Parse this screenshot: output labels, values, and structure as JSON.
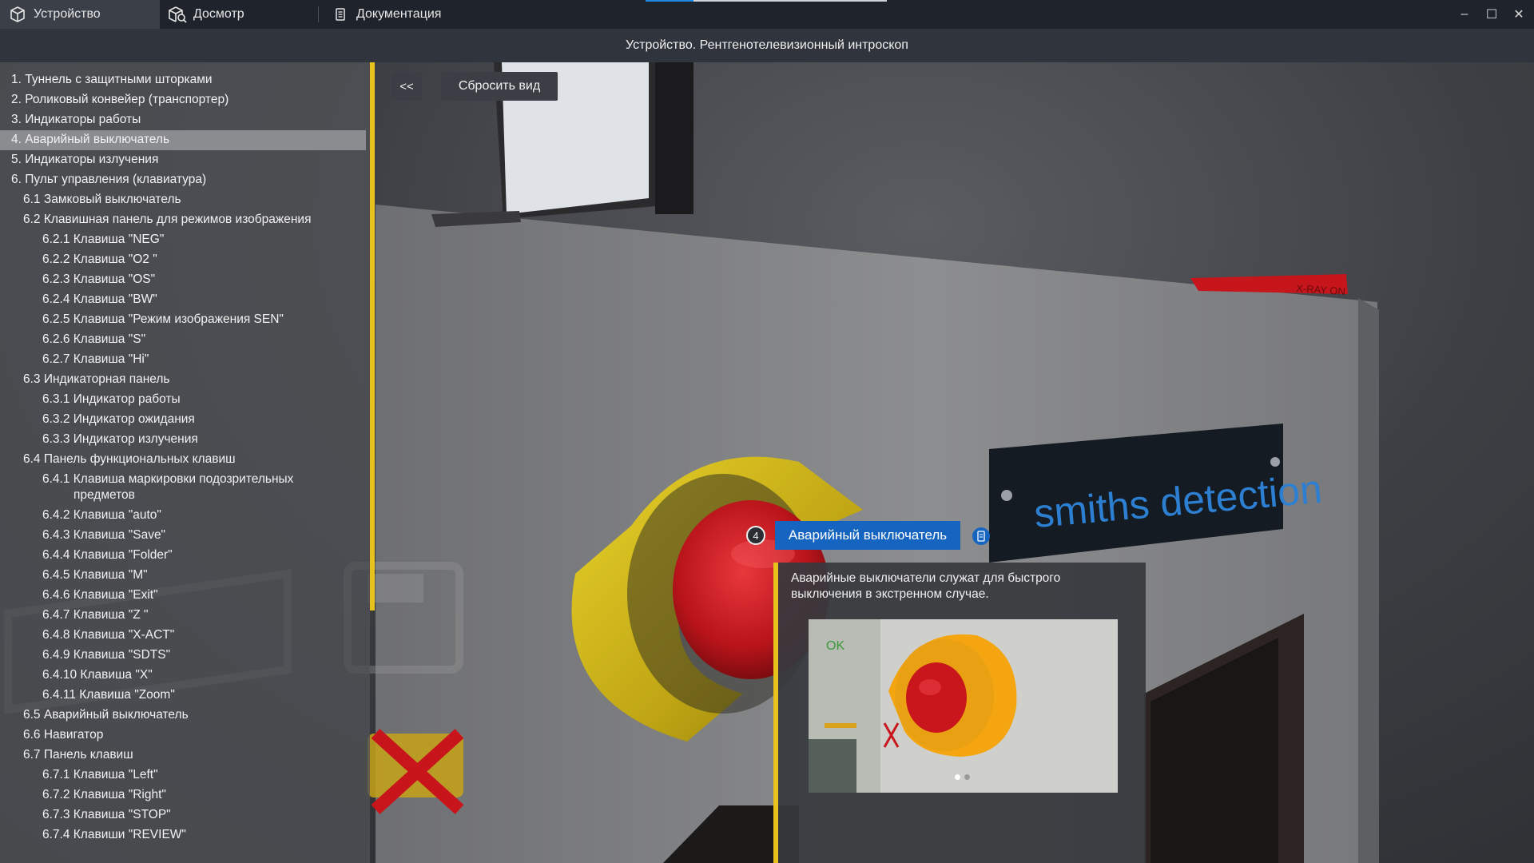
{
  "tabs": [
    {
      "label": "Устройство",
      "icon": "cube-icon",
      "active": true
    },
    {
      "label": "Досмотр",
      "icon": "cube-search-icon",
      "active": false
    },
    {
      "label": "Документация",
      "icon": "document-icon",
      "active": false
    }
  ],
  "window_controls": {
    "minimize": "–",
    "maximize": "☐",
    "close": "✕"
  },
  "title": "Устройство. Рентгенотелевизионный интроскоп",
  "viewport": {
    "collapse_label": "<<",
    "reset_label": "Сбросить вид",
    "brand_plate": "smiths detection",
    "xray_sign": "X-RAY ON"
  },
  "sidebar": {
    "items": [
      {
        "label": "1.  Туннель с защитными шторками",
        "level": 1
      },
      {
        "label": "2.  Роликовый конвейер (транспортер)",
        "level": 1
      },
      {
        "label": "3.  Индикаторы работы",
        "level": 1
      },
      {
        "label": "4.  Аварийный выключатель",
        "level": 1,
        "selected": true
      },
      {
        "label": "5.  Индикаторы излучения",
        "level": 1
      },
      {
        "label": "6.  Пульт управления (клавиатура)",
        "level": 1
      },
      {
        "label": "6.1  Замковый выключатель",
        "level": 2
      },
      {
        "label": "6.2  Клавишная панель для режимов изображения",
        "level": 2
      },
      {
        "label": "6.2.1 Клавиша \"NEG\"",
        "level": 3
      },
      {
        "label": "6.2.2 Клавиша \"O2 \"",
        "level": 3
      },
      {
        "label": "6.2.3 Клавиша \"OS\"",
        "level": 3
      },
      {
        "label": "6.2.4 Клавиша \"BW\"",
        "level": 3
      },
      {
        "label": "6.2.5 Клавиша \"Режим изображения SEN\"",
        "level": 3
      },
      {
        "label": "6.2.6 Клавиша \"S\"",
        "level": 3
      },
      {
        "label": "6.2.7 Клавиша \"Hi\"",
        "level": 3
      },
      {
        "label": "6.3  Индикаторная панель",
        "level": 2
      },
      {
        "label": "6.3.1 Индикатор работы",
        "level": 3
      },
      {
        "label": "6.3.2 Индикатор ожидания",
        "level": 3
      },
      {
        "label": "6.3.3 Индикатор излучения",
        "level": 3
      },
      {
        "label": "6.4  Панель функциональных клавиш",
        "level": 2
      },
      {
        "label": "6.4.1  Клавиша маркировки подозрительных",
        "continuation": "предметов",
        "level": 3
      },
      {
        "label": "6.4.2 Клавиша \"auto\"",
        "level": 3
      },
      {
        "label": "6.4.3 Клавиша \"Save\"",
        "level": 3
      },
      {
        "label": "6.4.4 Клавиша \"Folder\"",
        "level": 3
      },
      {
        "label": "6.4.5 Клавиша \"M\"",
        "level": 3
      },
      {
        "label": "6.4.6 Клавиша \"Exit\"",
        "level": 3
      },
      {
        "label": "6.4.7 Клавиша \"Z \"",
        "level": 3
      },
      {
        "label": "6.4.8 Клавиша \"X-ACT\"",
        "level": 3
      },
      {
        "label": "6.4.9 Клавиша \"SDTS\"",
        "level": 3
      },
      {
        "label": "6.4.10  Клавиша \"X\"",
        "level": 3
      },
      {
        "label": "6.4.11  Клавиша \"Zoom\"",
        "level": 3
      },
      {
        "label": "6.5  Аварийный выключатель",
        "level": 2
      },
      {
        "label": "6.6  Навигатор",
        "level": 2
      },
      {
        "label": "6.7  Панель клавиш",
        "level": 2
      },
      {
        "label": "6.7.1 Клавиша \"Left\"",
        "level": 3
      },
      {
        "label": "6.7.2 Клавиша \"Right\"",
        "level": 3
      },
      {
        "label": "6.7.3 Клавиша \"STOP\"",
        "level": 3
      },
      {
        "label": "6.7.4 Клавиши \"REVIEW\"",
        "level": 3
      }
    ]
  },
  "callout": {
    "number": "4",
    "label": "Аварийный выключатель",
    "description": "Аварийные выключатели служат для быстрого выключения в экстренном случае.",
    "image_panel_text": "OK",
    "slides_total": 2,
    "slide_active": 1
  },
  "colors": {
    "accent_yellow": "#e8c21c",
    "label_blue": "#1565c0",
    "button_red": "#c8141b",
    "guard_yellow": "#d9c015"
  }
}
